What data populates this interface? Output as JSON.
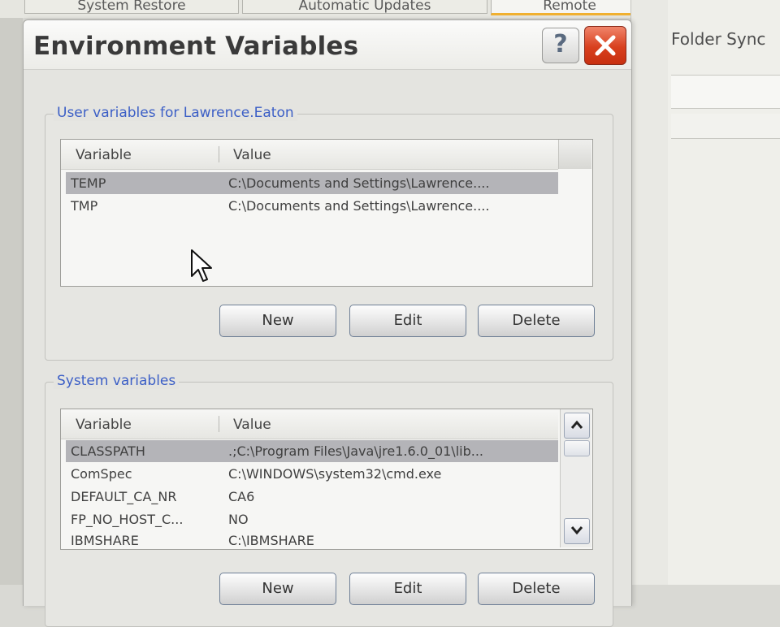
{
  "background": {
    "tabs": [
      "System Restore",
      "Automatic Updates",
      "Remote"
    ],
    "right_panel_label": "Folder Sync"
  },
  "dialog": {
    "title": "Environment Variables",
    "help_label": "?"
  },
  "user_section": {
    "label": "User variables for Lawrence.Eaton",
    "columns": [
      "Variable",
      "Value"
    ],
    "rows": [
      {
        "variable": "TEMP",
        "value": "C:\\Documents and Settings\\Lawrence...."
      },
      {
        "variable": "TMP",
        "value": "C:\\Documents and Settings\\Lawrence...."
      }
    ],
    "buttons": {
      "new": "New",
      "edit": "Edit",
      "delete": "Delete"
    }
  },
  "system_section": {
    "label": "System variables",
    "columns": [
      "Variable",
      "Value"
    ],
    "rows": [
      {
        "variable": "CLASSPATH",
        "value": ".;C:\\Program Files\\Java\\jre1.6.0_01\\lib..."
      },
      {
        "variable": "ComSpec",
        "value": "C:\\WINDOWS\\system32\\cmd.exe"
      },
      {
        "variable": "DEFAULT_CA_NR",
        "value": "CA6"
      },
      {
        "variable": "FP_NO_HOST_C...",
        "value": "NO"
      },
      {
        "variable": "IBMSHARE",
        "value": "C:\\IBMSHARE"
      }
    ],
    "buttons": {
      "new": "New",
      "edit": "Edit",
      "delete": "Delete"
    }
  },
  "colors": {
    "group_label": "#3c5fc6",
    "selected_row": "#b4b4b8",
    "close_button": "#d8401e"
  },
  "icons": [
    "help-icon",
    "close-icon",
    "scroll-up-icon",
    "scroll-down-icon",
    "mouse-cursor-icon"
  ]
}
